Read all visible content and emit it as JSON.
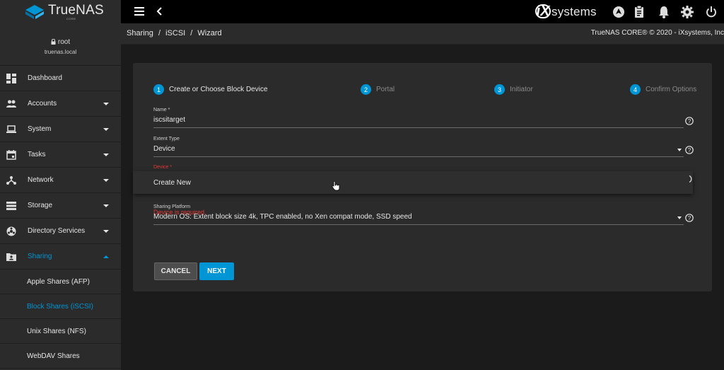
{
  "topbar": {
    "logo_name": "TrueNAS",
    "logo_sub": "CORE",
    "vendor_mark": "iX",
    "vendor_text": "systems"
  },
  "sidebar": {
    "user": "root",
    "host": "truenas.local",
    "items": [
      {
        "label": "Dashboard",
        "icon": "dashboard-icon"
      },
      {
        "label": "Accounts",
        "icon": "people-icon"
      },
      {
        "label": "System",
        "icon": "laptop-icon"
      },
      {
        "label": "Tasks",
        "icon": "calendar-icon"
      },
      {
        "label": "Network",
        "icon": "network-icon"
      },
      {
        "label": "Storage",
        "icon": "storage-icon"
      },
      {
        "label": "Directory Services",
        "icon": "directory-icon"
      },
      {
        "label": "Sharing",
        "icon": "sharing-icon"
      }
    ],
    "sub_items": [
      {
        "label": "Apple Shares (AFP)"
      },
      {
        "label": "Block Shares (iSCSI)"
      },
      {
        "label": "Unix Shares (NFS)"
      },
      {
        "label": "WebDAV Shares"
      }
    ]
  },
  "breadcrumb": {
    "items": [
      "Sharing",
      "/",
      "iSCSI",
      "/",
      "Wizard"
    ],
    "copyright": "TrueNAS CORE® © 2020 - iXsystems, Inc"
  },
  "wizard": {
    "steps": [
      {
        "num": "1",
        "label": "Create or Choose Block Device"
      },
      {
        "num": "2",
        "label": "Portal"
      },
      {
        "num": "3",
        "label": "Initiator"
      },
      {
        "num": "4",
        "label": "Confirm Options"
      }
    ],
    "name_label": "Name *",
    "name_value": "iscsitarget",
    "extent_label": "Extent Type",
    "extent_value": "Device",
    "device_label": "Device *",
    "device_error": "Device is required.",
    "dropdown_option": "Create New",
    "platform_label": "Sharing Platform",
    "platform_value": "Modern OS: Extent block size 4k, TPC enabled, no Xen compat mode, SSD speed",
    "cancel_label": "CANCEL",
    "next_label": "NEXT"
  },
  "colors": {
    "accent": "#0095d5",
    "error": "#e53935",
    "card": "#2b2b2b",
    "background": "#1b1b1b"
  }
}
